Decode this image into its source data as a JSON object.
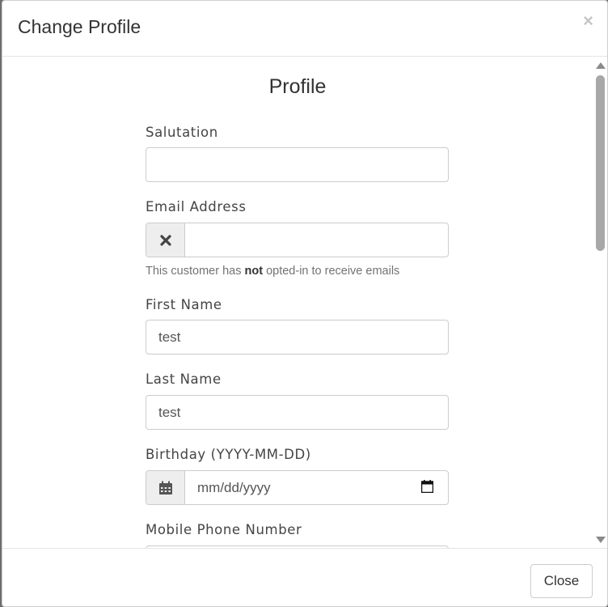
{
  "modal": {
    "title": "Change Profile",
    "close_glyph": "×",
    "close_icon": "close-icon"
  },
  "body": {
    "section_title": "Profile",
    "fields": {
      "salutation": {
        "label": "Salutation",
        "value": ""
      },
      "email": {
        "label": "Email Address",
        "value": "",
        "addon_icon": "times-icon",
        "help_prefix": "This customer has ",
        "help_bold": "not",
        "help_suffix": " opted-in to receive emails"
      },
      "first_name": {
        "label": "First Name",
        "value": "test"
      },
      "last_name": {
        "label": "Last Name",
        "value": "test"
      },
      "birthday": {
        "label": "Birthday (YYYY-MM-DD)",
        "placeholder": "mm/dd/yyyy",
        "addon_icon": "calendar-icon"
      },
      "mobile": {
        "label": "Mobile Phone Number",
        "value": ""
      }
    }
  },
  "footer": {
    "close_label": "Close"
  }
}
